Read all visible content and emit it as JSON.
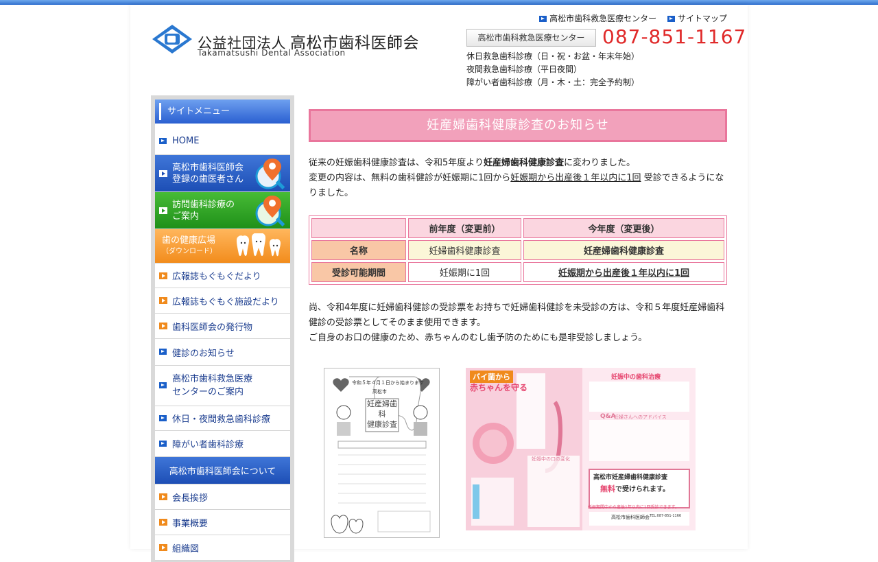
{
  "header": {
    "org_prefix": "公益社団法人",
    "org_name": "高松市歯科医師会",
    "org_en": "Takamatsushi Dental Association",
    "links": [
      "高松市歯科救急医療センター",
      "サイトマップ"
    ],
    "emergency_button": "高松市歯科救急医療センター",
    "phone": "087-851-1167",
    "hours": [
      "休日救急歯科診療（日・祝・お盆・年末年始）",
      "夜間救急歯科診療（平日夜間）",
      "障がい者歯科診療（月・木・土：完全予約制）"
    ]
  },
  "sidebar": {
    "title": "サイトメニュー",
    "home": "HOME",
    "dentists": [
      "高松市歯科医師会",
      "登録の歯医者さん"
    ],
    "visit": [
      "訪問歯科診療の",
      "ご案内"
    ],
    "health": [
      "歯の健康広場",
      "（ダウンロード）"
    ],
    "items1": [
      "広報誌もぐもぐだより",
      "広報誌もぐもぐ施設だより",
      "歯科医師会の発行物",
      "健診のお知らせ"
    ],
    "center": [
      "高松市歯科救急医療",
      "センターのご案内"
    ],
    "items2": [
      "休日・夜間救急歯科診療",
      "障がい者歯科診療"
    ],
    "about_header": "高松市歯科医師会について",
    "items3": [
      "会長挨拶",
      "事業概要",
      "組織図"
    ]
  },
  "main": {
    "title": "妊産婦歯科健康診査のお知らせ",
    "p1": {
      "a": "従来の妊娠歯科健康診査は、令和5年度より",
      "b": "妊産婦歯科健康診査",
      "c": "に変わりました。",
      "d": "変更の内容は、無料の歯科健診が妊娠期に1回から",
      "e": "妊娠期から出産後１年以内に1回",
      "f": " 受診できるようになりました。"
    },
    "table": {
      "head": [
        "",
        "前年度（変更前）",
        "今年度（変更後）"
      ],
      "rows": [
        [
          "名称",
          "妊婦歯科健康診査",
          "妊産婦歯科健康診査"
        ],
        [
          "受診可能期間",
          "妊娠期に1回",
          "妊娠期から出産後１年以内に1回"
        ]
      ]
    },
    "p2": {
      "a": "尚、令和4年度に妊婦歯科健診の受診票をお持ちで妊婦歯科健診を未受診の方は、令和５年度妊産婦歯科健診の受診票としてそのまま使用できます。",
      "b": "ご自身のお口の健康のため、赤ちゃんのむし歯予防のためにも是非受診しましょう。"
    },
    "leaflet1": {
      "top": "令和５年４月１日から始まります",
      "city": "高松市",
      "title1": "妊産婦歯科",
      "title2": "健康診査"
    },
    "leaflet2": {
      "a": "バイ菌から",
      "b": "赤ちゃんを守る",
      "c": "妊娠中の歯科治療",
      "d": "Q&A",
      "e": "妊婦さんへのアドバイス",
      "f": "妊娠中の口の変化",
      "g": "高松市妊産婦歯科健康診査",
      "h": "無料",
      "i": "で受けられます。",
      "j": "妊娠期間中から産後1年以内に1回受診できます。",
      "k": "高松市歯科医師会",
      "l": "TEL:087-851-1166"
    }
  },
  "colors": {
    "accent_blue": "#1a5fc9",
    "pink": "#e9769c",
    "phone_red": "#e02a2a"
  }
}
